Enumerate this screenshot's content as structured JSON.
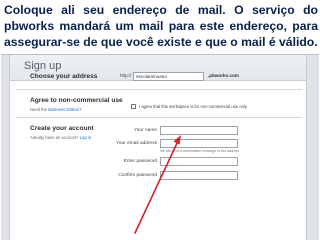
{
  "caption": "Coloque ali seu endereço de mail. O serviço do pbworks mandará um mail para este endereço, para assegurar-se de que você existe e que o mail é válido.",
  "signup": {
    "title": "Sign up",
    "address_section": {
      "title": "Choose your address",
      "prefix": "http://",
      "input_value": "escolaminuano",
      "suffix": ".pbworks.com"
    },
    "agree_section": {
      "title": "Agree to non-commercial use",
      "sub_prefix": "Need the",
      "sub_link": "Business Edition?",
      "checkbox_label": "I agree that this workspace is for non-commercial use only"
    },
    "account_section": {
      "title": "Create your account",
      "sub_prefix": "Already have an account?",
      "sub_link": "Log in",
      "fields": {
        "name_label": "Your name",
        "email_label": "Your email address",
        "email_hint": "We will send a confirmation message to this address",
        "password_label": "Enter password",
        "confirm_label": "Confirm password"
      }
    }
  },
  "colors": {
    "caption": "#0b1f4d",
    "arrow": "#d42424",
    "link": "#2a6bc2"
  }
}
